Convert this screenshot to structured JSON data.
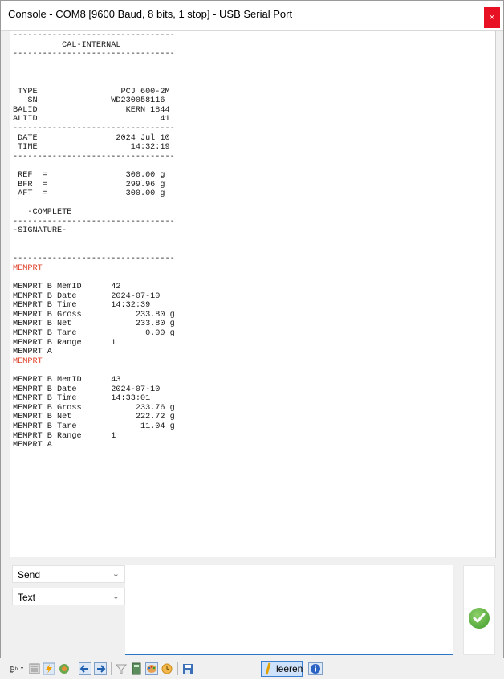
{
  "window": {
    "title": "Console - COM8 [9600 Baud, 8 bits, 1 stop] - USB Serial Port",
    "close_glyph": "×"
  },
  "console": {
    "lines": [
      {
        "text": "---------------------------------",
        "color": "normal"
      },
      {
        "text": "          CAL-INTERNAL",
        "color": "normal"
      },
      {
        "text": "---------------------------------",
        "color": "normal"
      },
      {
        "text": "",
        "color": "normal"
      },
      {
        "text": "",
        "color": "normal"
      },
      {
        "text": "",
        "color": "normal"
      },
      {
        "text": " TYPE                 PCJ 600-2M",
        "color": "normal"
      },
      {
        "text": "   SN               WD230058116",
        "color": "normal"
      },
      {
        "text": "BALID                  KERN 1844",
        "color": "normal"
      },
      {
        "text": "ALIID                         41",
        "color": "normal"
      },
      {
        "text": "---------------------------------",
        "color": "normal"
      },
      {
        "text": " DATE                2024 Jul 10",
        "color": "normal"
      },
      {
        "text": " TIME                   14:32:19",
        "color": "normal"
      },
      {
        "text": "---------------------------------",
        "color": "normal"
      },
      {
        "text": "",
        "color": "normal"
      },
      {
        "text": " REF  =                300.00 g",
        "color": "normal"
      },
      {
        "text": " BFR  =                299.96 g",
        "color": "normal"
      },
      {
        "text": " AFT  =                300.00 g",
        "color": "normal"
      },
      {
        "text": "",
        "color": "normal"
      },
      {
        "text": "   -COMPLETE",
        "color": "normal"
      },
      {
        "text": "---------------------------------",
        "color": "normal"
      },
      {
        "text": "-SIGNATURE-",
        "color": "normal"
      },
      {
        "text": "",
        "color": "normal"
      },
      {
        "text": "",
        "color": "normal"
      },
      {
        "text": "---------------------------------",
        "color": "normal"
      },
      {
        "text": "MEMPRT",
        "color": "red"
      },
      {
        "text": "",
        "color": "normal"
      },
      {
        "text": "MEMPRT B MemID      42",
        "color": "normal"
      },
      {
        "text": "MEMPRT B Date       2024-07-10",
        "color": "normal"
      },
      {
        "text": "MEMPRT B Time       14:32:39",
        "color": "normal"
      },
      {
        "text": "MEMPRT B Gross           233.80 g",
        "color": "normal"
      },
      {
        "text": "MEMPRT B Net             233.80 g",
        "color": "normal"
      },
      {
        "text": "MEMPRT B Tare              0.00 g",
        "color": "normal"
      },
      {
        "text": "MEMPRT B Range      1",
        "color": "normal"
      },
      {
        "text": "MEMPRT A",
        "color": "normal"
      },
      {
        "text": "MEMPRT",
        "color": "red"
      },
      {
        "text": "",
        "color": "normal"
      },
      {
        "text": "MEMPRT B MemID      43",
        "color": "normal"
      },
      {
        "text": "MEMPRT B Date       2024-07-10",
        "color": "normal"
      },
      {
        "text": "MEMPRT B Time       14:33:01",
        "color": "normal"
      },
      {
        "text": "MEMPRT B Gross           233.76 g",
        "color": "normal"
      },
      {
        "text": "MEMPRT B Net             222.72 g",
        "color": "normal"
      },
      {
        "text": "MEMPRT B Tare             11.04 g",
        "color": "normal"
      },
      {
        "text": "MEMPRT B Range      1",
        "color": "normal"
      },
      {
        "text": "MEMPRT A",
        "color": "normal"
      }
    ]
  },
  "send_panel": {
    "mode_select": {
      "value": "Send",
      "chevron": "⌄"
    },
    "format_select": {
      "value": "Text",
      "chevron": "⌄"
    },
    "input_value": ""
  },
  "toolbar": {
    "leeren_label": "leeren",
    "icons": [
      "terminal-dropdown-icon",
      "list-icon",
      "lightning-icon",
      "plugin-icon",
      "arrow-left-icon",
      "arrow-right-icon",
      "filter-icon",
      "calculator-icon",
      "palette-icon",
      "clock-icon",
      "save-icon",
      "clear-icon",
      "info-icon"
    ]
  },
  "colors": {
    "accent": "#2b77c5",
    "red_text": "#e0402a",
    "close": "#e81123",
    "ok_green": "#3f9b2a"
  }
}
